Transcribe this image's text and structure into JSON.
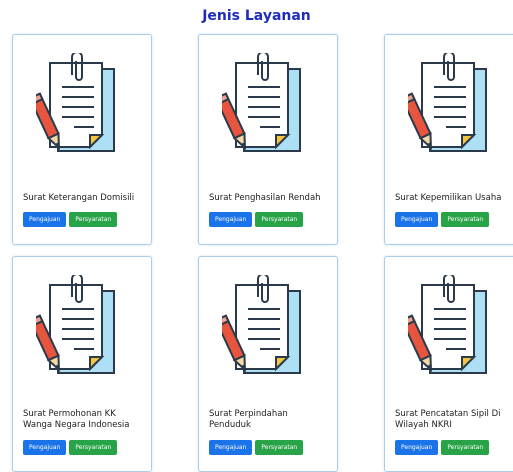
{
  "page": {
    "title": "Jenis Layanan"
  },
  "icons": {
    "card_illustration": "document-with-pencil-icon"
  },
  "colors": {
    "title": "#1f2dbf",
    "primary": "#1a73e8",
    "success": "#29a347",
    "card_border": "#a9cdea"
  },
  "services": [
    {
      "title": "Surat Keterangan Domisili",
      "btn_primary": "Pengajuan",
      "btn_success": "Persyaratan"
    },
    {
      "title": "Surat Penghasilan Rendah",
      "btn_primary": "Pengajuan",
      "btn_success": "Persyaratan"
    },
    {
      "title": "Surat Kepemilikan Usaha",
      "btn_primary": "Pengajuan",
      "btn_success": "Persyaratan"
    },
    {
      "title": "Surat Permohonan KK Wanga Negara Indonesia",
      "btn_primary": "Pengajuan",
      "btn_success": "Persyaratan"
    },
    {
      "title": "Surat Perpindahan Penduduk",
      "btn_primary": "Pengajuan",
      "btn_success": "Persyaratan"
    },
    {
      "title": "Surat Pencatatan Sipil Di Wilayah NKRI",
      "btn_primary": "Pengajuan",
      "btn_success": "Persyaratan"
    }
  ]
}
